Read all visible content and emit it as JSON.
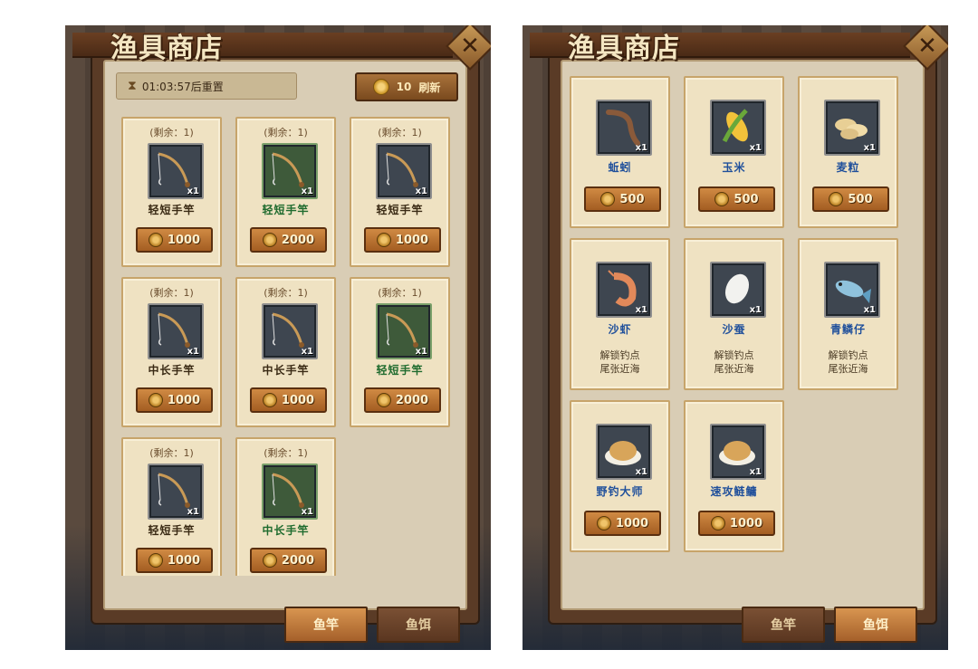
{
  "shop": {
    "title": "渔具商店",
    "close_icon": "close-icon"
  },
  "left": {
    "reset_text": "01:03:57后重置",
    "refresh_cost": "10",
    "refresh_label": "刷新",
    "items": [
      {
        "remain": "(剩余：1)",
        "qty": "x1",
        "name": "轻短手竿",
        "price": "1000",
        "rarity": "normal"
      },
      {
        "remain": "(剩余：1)",
        "qty": "x1",
        "name": "轻短手竿",
        "price": "2000",
        "rarity": "green"
      },
      {
        "remain": "(剩余：1)",
        "qty": "x1",
        "name": "轻短手竿",
        "price": "1000",
        "rarity": "normal"
      },
      {
        "remain": "(剩余：1)",
        "qty": "x1",
        "name": "中长手竿",
        "price": "1000",
        "rarity": "normal"
      },
      {
        "remain": "(剩余：1)",
        "qty": "x1",
        "name": "中长手竿",
        "price": "1000",
        "rarity": "normal"
      },
      {
        "remain": "(剩余：1)",
        "qty": "x1",
        "name": "轻短手竿",
        "price": "2000",
        "rarity": "green"
      },
      {
        "remain": "(剩余：1)",
        "qty": "x1",
        "name": "轻短手竿",
        "price": "1000",
        "rarity": "normal"
      },
      {
        "remain": "(剩余：1)",
        "qty": "x1",
        "name": "中长手竿",
        "price": "2000",
        "rarity": "green"
      }
    ],
    "tabs": {
      "rod": "鱼竿",
      "bait": "鱼饵"
    }
  },
  "right": {
    "items": [
      {
        "qty": "x1",
        "name": "蚯蚓",
        "price": "500",
        "icon": "worm-icon"
      },
      {
        "qty": "x1",
        "name": "玉米",
        "price": "500",
        "icon": "corn-icon"
      },
      {
        "qty": "x1",
        "name": "麦粒",
        "price": "500",
        "icon": "wheat-icon"
      },
      {
        "qty": "x1",
        "name": "沙虾",
        "unlock_line1": "解锁钓点",
        "unlock_line2": "尾张近海",
        "icon": "shrimp-icon"
      },
      {
        "qty": "x1",
        "name": "沙蚕",
        "unlock_line1": "解锁钓点",
        "unlock_line2": "尾张近海",
        "icon": "sandworm-icon"
      },
      {
        "qty": "x1",
        "name": "青鳞仔",
        "unlock_line1": "解锁钓点",
        "unlock_line2": "尾张近海",
        "icon": "fish-icon"
      },
      {
        "qty": "x1",
        "name": "野钓大师",
        "price": "1000",
        "icon": "bait-powder-icon"
      },
      {
        "qty": "x1",
        "name": "速攻鲢鳙",
        "price": "1000",
        "icon": "bait-powder-icon"
      }
    ],
    "tabs": {
      "rod": "鱼竿",
      "bait": "鱼饵"
    }
  }
}
